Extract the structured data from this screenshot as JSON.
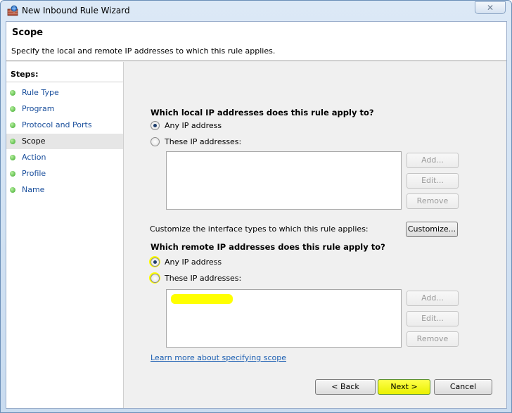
{
  "window": {
    "title": "New Inbound Rule Wizard",
    "close_label": "✕"
  },
  "header": {
    "title": "Scope",
    "description": "Specify the local and remote IP addresses to which this rule applies."
  },
  "steps": {
    "title": "Steps:",
    "items": [
      {
        "label": "Rule Type"
      },
      {
        "label": "Program"
      },
      {
        "label": "Protocol and Ports"
      },
      {
        "label": "Scope"
      },
      {
        "label": "Action"
      },
      {
        "label": "Profile"
      },
      {
        "label": "Name"
      }
    ],
    "active_index": 3
  },
  "local": {
    "question": "Which local IP addresses does this rule apply to?",
    "options": [
      "Any IP address",
      "These IP addresses:"
    ],
    "selected": 0,
    "buttons": {
      "add": "Add...",
      "edit": "Edit...",
      "remove": "Remove"
    }
  },
  "interface": {
    "text": "Customize the interface types to which this rule applies:",
    "button": "Customize..."
  },
  "remote": {
    "question": "Which remote IP addresses does this rule apply to?",
    "options": [
      "Any IP address",
      "These IP addresses:"
    ],
    "selected": 0,
    "buttons": {
      "add": "Add...",
      "edit": "Edit...",
      "remove": "Remove"
    }
  },
  "learn_more": "Learn more about specifying scope",
  "footer": {
    "back": "< Back",
    "next": "Next >",
    "cancel": "Cancel"
  },
  "colors": {
    "highlight": "#ffff00",
    "link": "#1c5fb2",
    "step_dot": "#3aa82a"
  }
}
